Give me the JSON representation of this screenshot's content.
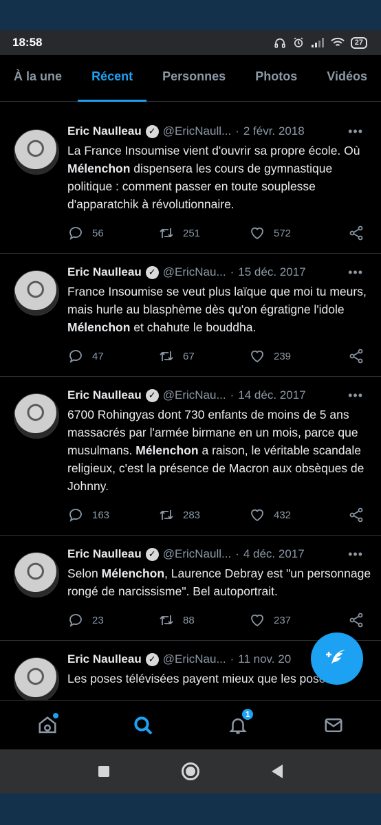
{
  "status": {
    "time": "18:58",
    "battery": "27"
  },
  "tabs": [
    "À la une",
    "Récent",
    "Personnes",
    "Photos",
    "Vidéos"
  ],
  "active_tab": "Récent",
  "tweets": [
    {
      "name": "Eric Naulleau",
      "handle": "@EricNaull...",
      "date": "2 févr. 2018",
      "text_1": "La France Insoumise vient d'ouvrir sa propre école. Où ",
      "bold": "Mélenchon",
      "text_2": " dispensera les cours de gymnastique politique : comment passer en toute souplesse d'apparatchik à révolutionnaire.",
      "replies": "56",
      "retweets": "251",
      "likes": "572"
    },
    {
      "name": "Eric Naulleau",
      "handle": "@EricNau...",
      "date": "15 déc. 2017",
      "text_1": "France Insoumise se veut plus laïque que moi tu meurs, mais hurle au blasphème dès qu'on égratigne l'idole ",
      "bold": "Mélenchon",
      "text_2": " et chahute le bouddha.",
      "replies": "47",
      "retweets": "67",
      "likes": "239"
    },
    {
      "name": "Eric Naulleau",
      "handle": "@EricNau...",
      "date": "14 déc. 2017",
      "text_1": "6700 Rohingyas dont 730 enfants de moins de 5 ans massacrés par l'armée  birmane en un mois, parce que musulmans. ",
      "bold": "Mélenchon",
      "text_2": " a raison, le véritable scandale religieux, c'est la présence de Macron aux obsèques de Johnny.",
      "replies": "163",
      "retweets": "283",
      "likes": "432"
    },
    {
      "name": "Eric Naulleau",
      "handle": "@EricNaull...",
      "date": "4 déc. 2017",
      "text_1": "Selon ",
      "bold": "Mélenchon",
      "text_2": ", Laurence Debray est \"un personnage rongé de narcissisme\". Bel autoportrait.",
      "replies": "23",
      "retweets": "88",
      "likes": "237"
    },
    {
      "name": "Eric Naulleau",
      "handle": "@EricNau...",
      "date": "11 nov. 20",
      "text_1": "Les poses télévisées payent mieux que les poses",
      "bold": "",
      "text_2": "",
      "replies": "",
      "retweets": "",
      "likes": ""
    }
  ],
  "notifications_badge": "1",
  "colors": {
    "accent": "#1da1f2",
    "background": "#000000",
    "muted": "#8b98a5"
  },
  "icons": {
    "reply": "reply-icon",
    "retweet": "retweet-icon",
    "like": "heart-icon",
    "share": "share-icon",
    "compose": "compose-tweet-icon",
    "home": "home-icon",
    "search": "search-icon",
    "notifications": "bell-icon",
    "messages": "mail-icon"
  }
}
